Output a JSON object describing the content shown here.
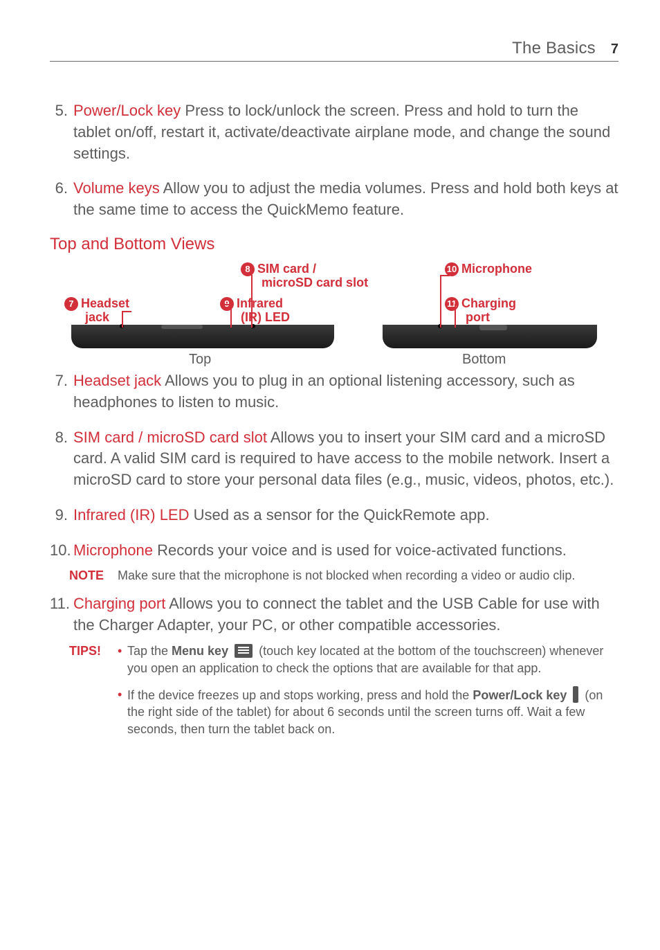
{
  "header": {
    "section": "The Basics",
    "page": "7"
  },
  "items": {
    "n5": {
      "num": "5.",
      "term": "Power/Lock key",
      "text": " Press to lock/unlock the screen. Press and hold to turn the tablet on/off, restart it, activate/deactivate airplane mode, and change the sound settings."
    },
    "n6": {
      "num": "6.",
      "term": "Volume keys",
      "text": " Allow you to adjust the media volumes. Press and hold both keys at the same time to access the QuickMemo feature."
    },
    "n7": {
      "num": "7.",
      "term": "Headset jack",
      "text": " Allows you to plug in an optional listening accessory, such as headphones to listen to music."
    },
    "n8": {
      "num": "8.",
      "term": "SIM card / microSD card slot",
      "text": " Allows you to insert your SIM card and a microSD card. A valid SIM card is required to have access to the mobile network. Insert a microSD card to store your personal data files (e.g., music, videos, photos, etc.)."
    },
    "n9": {
      "num": "9.",
      "term": "Infrared (IR) LED",
      "text": " Used as a sensor for the QuickRemote app."
    },
    "n10": {
      "num": "10.",
      "term": "Microphone",
      "text": " Records your voice and is used for voice-activated functions."
    },
    "n11": {
      "num": "11.",
      "term": "Charging port",
      "text": " Allows you to connect the tablet and the USB Cable for use with the Charger Adapter, your PC, or other compatible accessories."
    }
  },
  "heading": "Top and Bottom Views",
  "diagram": {
    "top_label": "Top",
    "bottom_label": "Bottom",
    "c7": {
      "badge": "7",
      "l1": "Headset",
      "l2": "jack"
    },
    "c8": {
      "badge": "8",
      "l1": "SIM card /",
      "l2": "microSD card slot"
    },
    "c9": {
      "badge": "9",
      "l1": "Infrared",
      "l2": "(IR) LED"
    },
    "c10": {
      "badge": "10",
      "l1": "Microphone"
    },
    "c11": {
      "badge": "11",
      "l1": "Charging",
      "l2": "port"
    }
  },
  "note": {
    "label": "NOTE",
    "text": "Make sure that the microphone is not blocked when recording a video or audio clip."
  },
  "tips": {
    "label": "TIPS!",
    "t1a": "Tap the ",
    "t1b": "Menu key",
    "t1c": " (touch key located at the bottom of the touchscreen) whenever you open an application to check the options that are available for that app.",
    "t2a": "If the device freezes up and stops working, press and hold the ",
    "t2b": "Power/Lock key",
    "t2c": " (on the right side of the tablet) for about 6 seconds until the screen turns off. Wait a few seconds, then turn the tablet back on."
  }
}
